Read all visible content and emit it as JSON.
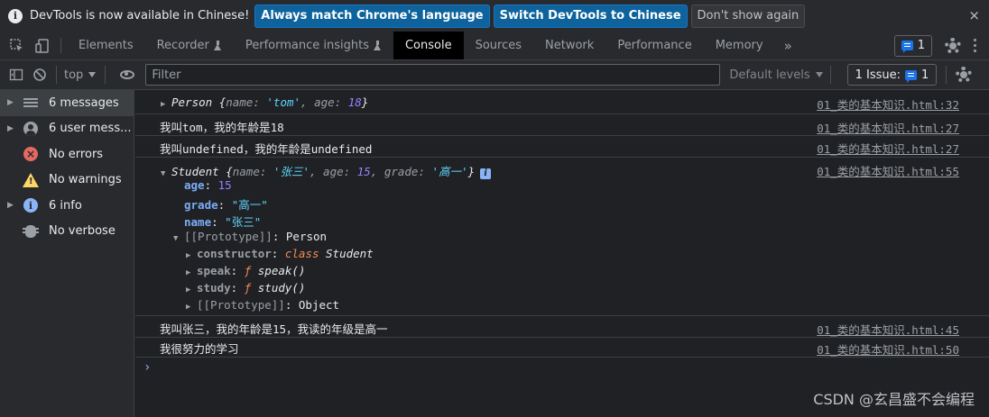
{
  "infobar": {
    "message": "DevTools is now available in Chinese!",
    "btn_match": "Always match Chrome's language",
    "btn_switch": "Switch DevTools to Chinese",
    "btn_dismiss": "Don't show again",
    "close": "×"
  },
  "tabs": [
    {
      "label": "Elements"
    },
    {
      "label": "Recorder",
      "icon": "flask-icon"
    },
    {
      "label": "Performance insights",
      "icon": "flask-icon"
    },
    {
      "label": "Console",
      "active": true
    },
    {
      "label": "Sources"
    },
    {
      "label": "Network"
    },
    {
      "label": "Performance"
    },
    {
      "label": "Memory"
    }
  ],
  "toolbar": {
    "more_tabs": "»",
    "issues_count": "1"
  },
  "console_toolbar": {
    "context": "top",
    "filter_placeholder": "Filter",
    "levels": "Default levels",
    "issues_label": "1 Issue:",
    "issues_count": "1"
  },
  "sidebar": {
    "items": [
      {
        "label": "6 messages",
        "icon": "list-icon",
        "expandable": true,
        "selected": true
      },
      {
        "label": "6 user mess...",
        "icon": "user-icon",
        "expandable": true
      },
      {
        "label": "No errors",
        "icon": "error-icon",
        "expandable": false
      },
      {
        "label": "No warnings",
        "icon": "warning-icon",
        "expandable": false
      },
      {
        "label": "6 info",
        "icon": "info-icon",
        "expandable": true
      },
      {
        "label": "No verbose",
        "icon": "bug-icon",
        "expandable": false
      }
    ]
  },
  "console": {
    "messages": {
      "m1": {
        "class": "Person",
        "open": "{",
        "k1": "name",
        "v1": "'tom'",
        "k2": "age",
        "v2": "18",
        "close": "}",
        "source": "01_类的基本知识.html:32"
      },
      "m2": {
        "text": "我叫tom，我的年龄是18",
        "source": "01_类的基本知识.html:27"
      },
      "m3": {
        "text": "我叫undefined，我的年龄是undefined",
        "source": "01_类的基本知识.html:27"
      },
      "m4": {
        "class": "Student",
        "open": "{",
        "k1": "name",
        "v1": "'张三'",
        "k2": "age",
        "v2": "15",
        "k3": "grade",
        "v3": "'高一'",
        "close": "}",
        "source": "01_类的基本知识.html:55",
        "props": {
          "age_k": "age",
          "age_v": "15",
          "grade_k": "grade",
          "grade_v": "\"高一\"",
          "name_k": "name",
          "name_v": "\"张三\"",
          "proto_k": "[[Prototype]]",
          "proto_v": "Person",
          "ctor_k": "constructor",
          "ctor_kw": "class",
          "ctor_v": "Student",
          "speak_k": "speak",
          "speak_f": "ƒ",
          "speak_v": "speak()",
          "study_k": "study",
          "study_f": "ƒ",
          "study_v": "study()",
          "proto2_k": "[[Prototype]]",
          "proto2_v": "Object"
        }
      },
      "m5": {
        "text": "我叫张三，我的年龄是15，我读的年级是高一",
        "source": "01_类的基本知识.html:45"
      },
      "m6": {
        "text": "我很努力的学习",
        "source": "01_类的基本知识.html:50"
      }
    },
    "prompt": "›"
  },
  "watermark": "CSDN @玄昌盛不会编程",
  "colors": {
    "string": "#5cd5fb",
    "number": "#9980ff",
    "keyword": "#f28b54",
    "accent": "#0e639c"
  }
}
